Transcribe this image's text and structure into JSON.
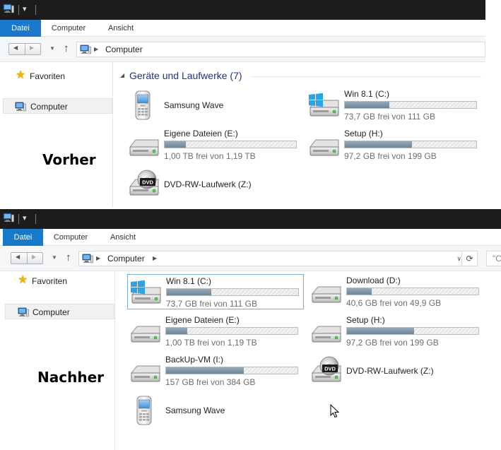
{
  "ribbon_tabs": [
    "Datei",
    "Computer",
    "Ansicht"
  ],
  "address": {
    "location": "Computer"
  },
  "search": {
    "placeholder": "\"C"
  },
  "sidebar": {
    "favorites": "Favoriten",
    "computer": "Computer"
  },
  "before": {
    "label": "Vorher",
    "group_header": "Geräte und Laufwerke (7)",
    "drives": [
      {
        "name": "Samsung Wave",
        "icon": "phone-icon"
      },
      {
        "name": "Win 8.1 (C:)",
        "free_text": "73,7 GB frei von 111 GB",
        "used_fraction": 0.34,
        "icon": "windows-drive-icon"
      },
      {
        "name": "Eigene Dateien (E:)",
        "free_text": "1,00 TB frei von 1,19 TB",
        "used_fraction": 0.16,
        "icon": "hard-drive-icon"
      },
      {
        "name": "Setup (H:)",
        "free_text": "97,2 GB frei von 199 GB",
        "used_fraction": 0.51,
        "icon": "hard-drive-icon"
      },
      {
        "name": "DVD-RW-Laufwerk (Z:)",
        "icon": "dvd-drive-icon"
      }
    ]
  },
  "after": {
    "label": "Nachher",
    "drives": [
      {
        "name": "Win 8.1 (C:)",
        "free_text": "73,7 GB frei von 111 GB",
        "used_fraction": 0.34,
        "icon": "windows-drive-icon"
      },
      {
        "name": "Download (D:)",
        "free_text": "40,6 GB frei von 49,9 GB",
        "used_fraction": 0.19,
        "icon": "hard-drive-icon"
      },
      {
        "name": "Eigene Dateien (E:)",
        "free_text": "1,00 TB frei von 1,19 TB",
        "used_fraction": 0.16,
        "icon": "hard-drive-icon"
      },
      {
        "name": "Setup (H:)",
        "free_text": "97,2 GB frei von 199 GB",
        "used_fraction": 0.51,
        "icon": "hard-drive-icon"
      },
      {
        "name": "BackUp-VM (I:)",
        "free_text": "157 GB frei von 384 GB",
        "used_fraction": 0.59,
        "icon": "hard-drive-icon"
      },
      {
        "name": "DVD-RW-Laufwerk (Z:)",
        "icon": "dvd-drive-icon"
      },
      {
        "name": "Samsung Wave",
        "icon": "phone-icon"
      }
    ]
  },
  "colors": {
    "accent": "#1979ca",
    "header": "#1e3287",
    "bar_fill": "#7b95a6",
    "titlebar": "#1c1c1c"
  }
}
